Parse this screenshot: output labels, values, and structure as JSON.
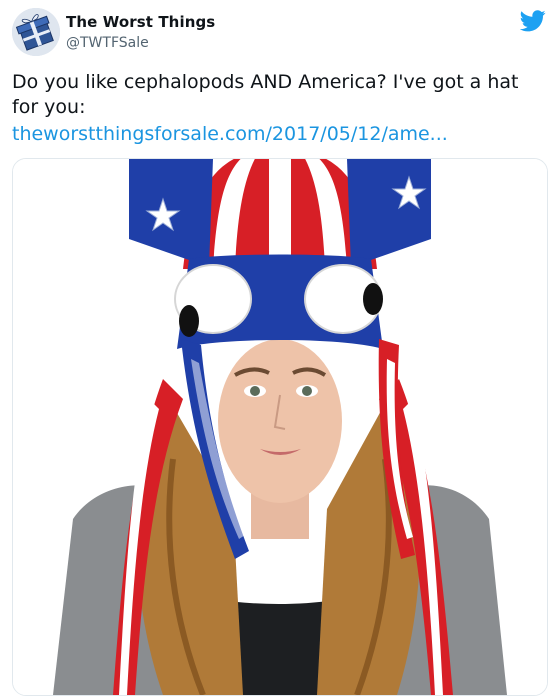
{
  "account": {
    "display_name": "The Worst Things",
    "handle": "@TWTFSale",
    "avatar_icon": "gift-box-avatar"
  },
  "brand_icon": "twitter-bird-icon",
  "tweet": {
    "text": "Do you like cephalopods AND America? I've got a hat for you:",
    "link": "theworstthingsforsale.com/2017/05/12/ame..."
  },
  "media": {
    "alt": "squid hat"
  },
  "colors": {
    "link": "#1b95e0",
    "bird": "#1da1f2",
    "hat_red": "#d71f26",
    "hat_blue": "#1f3fa8",
    "hat_white": "#ffffff"
  }
}
